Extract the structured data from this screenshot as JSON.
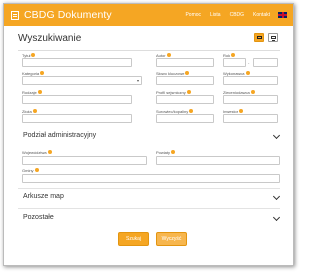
{
  "app": {
    "brand": "CBDG Dokumenty",
    "nav": [
      "Pomoc",
      "Lista",
      "CBDG",
      "Kontakt"
    ],
    "language_icon": "uk-flag-icon"
  },
  "search": {
    "title": "Wyszukiwanie",
    "view_icons": [
      "desktop-icon",
      "mobile-icon"
    ],
    "fields": {
      "tytul": "Tytuł",
      "autor": "Autor",
      "rok": "Rok",
      "kategoria": "Kategoria",
      "slowo": "Słowo kluczowe",
      "wykonawca": "Wykonawca",
      "rodzaje": "Rodzaje",
      "profil": "Profil sejsmiczny",
      "zleceniodawca": "Zleceniodawca",
      "zloza": "Złoża",
      "surowiec": "Surowiec/kopaliny",
      "inwestor": "Inwestor"
    },
    "rok_separator": "-"
  },
  "sections": {
    "podzial": {
      "label": "Podział administracyjny",
      "fields": {
        "wojewodztwa": "Województwa",
        "powiaty": "Powiaty",
        "gminy": "Gminy"
      }
    },
    "arkusze": {
      "label": "Arkusze map"
    },
    "pozostale": {
      "label": "Pozostałe"
    }
  },
  "buttons": {
    "search": "Szukaj",
    "clear": "Wyczyść"
  },
  "colors": {
    "accent": "#f5a623",
    "info": "#f5a623"
  }
}
